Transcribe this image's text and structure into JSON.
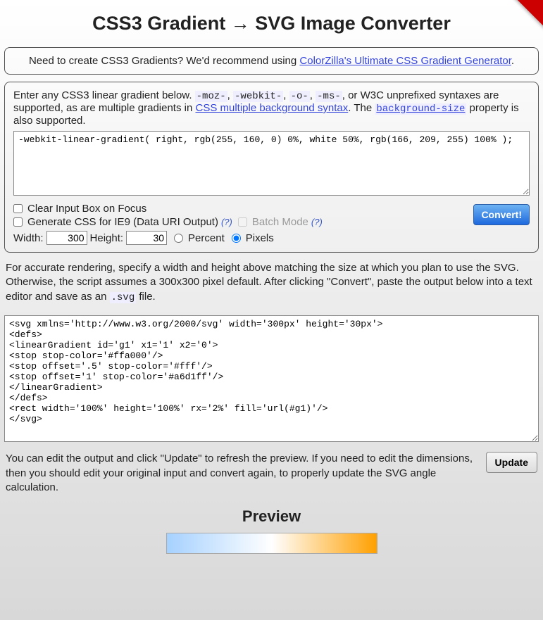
{
  "title": "CSS3 Gradient → SVG Image Converter",
  "info": {
    "prefix": "Need to create CSS3 Gradients? We'd recommend using ",
    "link": "ColorZilla's Ultimate CSS Gradient Generator",
    "suffix": "."
  },
  "input_panel": {
    "intro_a": "Enter any CSS3 linear gradient below. ",
    "code_moz": "-moz-",
    "intro_b": ", ",
    "code_webkit": "-webkit-",
    "intro_c": ", ",
    "code_o": "-o-",
    "intro_d": ", ",
    "code_ms": "-ms-",
    "intro_e": ", or W3C unprefixed syntaxes are supported, as are multiple gradients in ",
    "link_multi": "CSS multiple background syntax",
    "intro_f": ". The ",
    "code_bgsize": "background-size",
    "intro_g": " property is also supported.",
    "textarea_value": "-webkit-linear-gradient( right, rgb(255, 160, 0) 0%, white 50%, rgb(166, 209, 255) 100% );"
  },
  "options": {
    "clear_on_focus": "Clear Input Box on Focus",
    "ie9": "Generate CSS for IE9 (Data URI Output)",
    "help": "(?)",
    "batch": "Batch Mode",
    "convert": "Convert!",
    "width_label": "Width:",
    "width_value": "300",
    "height_label": "Height:",
    "height_value": "30",
    "percent": "Percent",
    "pixels": "Pixels"
  },
  "render_note_a": "For accurate rendering, specify a width and height above matching the size at which you plan to use the SVG. Otherwise, the script assumes a 300x300 pixel default. After clicking \"Convert\", paste the output below into a text editor and save as an ",
  "render_note_code": ".svg",
  "render_note_b": " file.",
  "output_value": "<svg xmlns='http://www.w3.org/2000/svg' width='300px' height='30px'>\n<defs>\n<linearGradient id='g1' x1='1' x2='0'>\n<stop stop-color='#ffa000'/>\n<stop offset='.5' stop-color='#fff'/>\n<stop offset='1' stop-color='#a6d1ff'/>\n</linearGradient>\n</defs>\n<rect width='100%' height='100%' rx='2%' fill='url(#g1)'/>\n</svg>",
  "update_note": "You can edit the output and click \"Update\" to refresh the preview. If you need to edit the dimensions, then you should edit your original input and convert again, to properly update the SVG angle calculation.",
  "update_btn": "Update",
  "preview_heading": "Preview"
}
